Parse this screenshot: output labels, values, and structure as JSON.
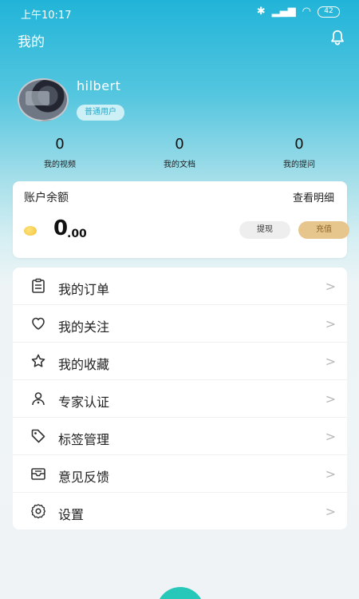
{
  "status_bar": {
    "time": "上午10:17",
    "battery": "42"
  },
  "header": {
    "title": "我的"
  },
  "profile": {
    "username": "hilbert",
    "badge": "普通用户"
  },
  "stats": [
    {
      "value": "0",
      "label": "我的视频"
    },
    {
      "value": "0",
      "label": "我的文档"
    },
    {
      "value": "0",
      "label": "我的提问"
    }
  ],
  "balance": {
    "title": "账户余额",
    "detail_link": "查看明细",
    "amount_int": "0",
    "amount_dec": ".00",
    "withdraw_label": "提现",
    "recharge_label": "充值"
  },
  "menu": [
    {
      "label": "我的订单",
      "icon": "order-icon"
    },
    {
      "label": "我的关注",
      "icon": "heart-icon"
    },
    {
      "label": "我的收藏",
      "icon": "star-icon"
    },
    {
      "label": "专家认证",
      "icon": "user-certify-icon"
    },
    {
      "label": "标签管理",
      "icon": "tag-icon"
    },
    {
      "label": "意见反馈",
      "icon": "mail-icon"
    },
    {
      "label": "设置",
      "icon": "gear-icon"
    }
  ],
  "colors": {
    "accent": "#21b4d8",
    "recharge": "#e7c68d",
    "fab": "#27c7b9"
  }
}
